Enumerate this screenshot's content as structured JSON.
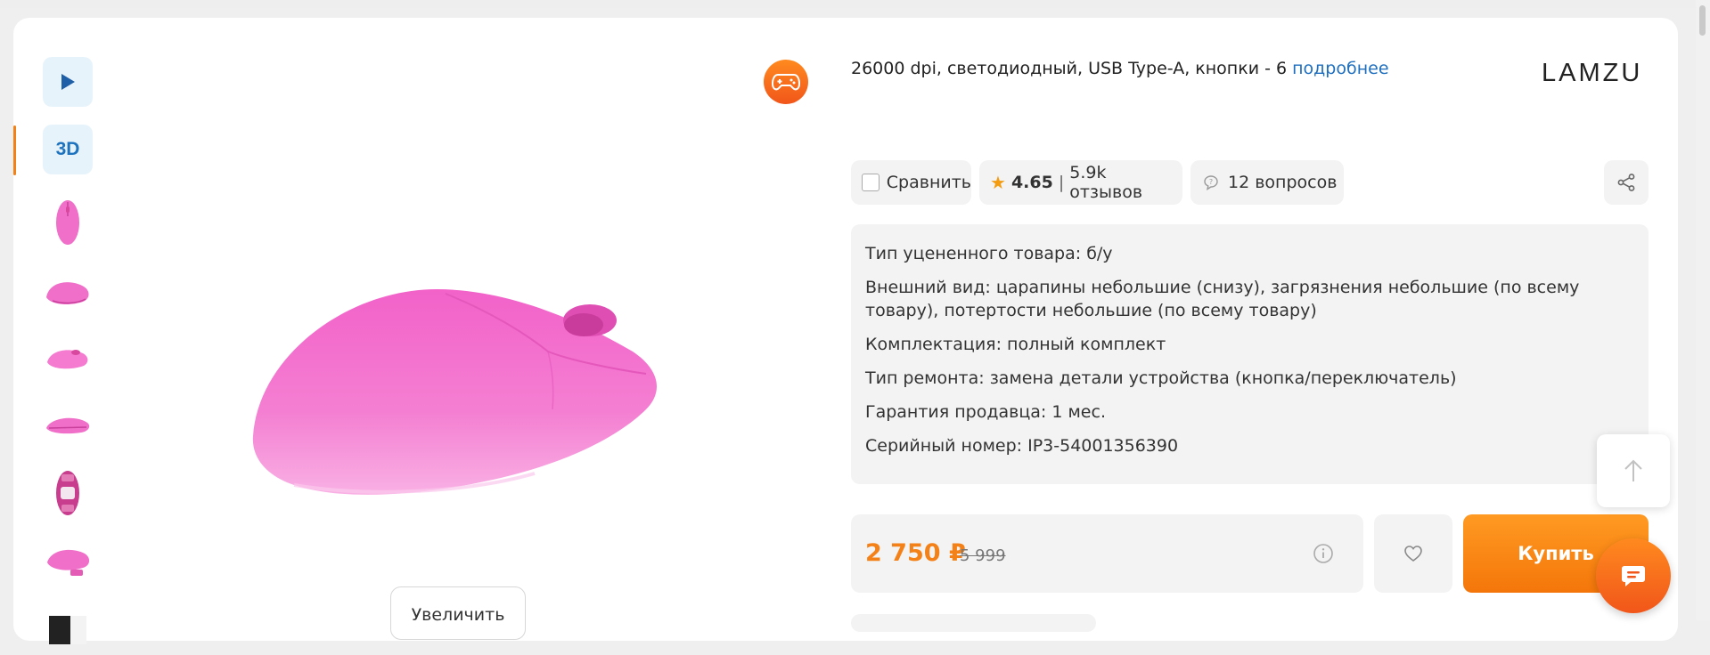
{
  "gallery": {
    "three_d_label": "3D",
    "zoom_label": "Увеличить"
  },
  "product": {
    "spec_summary": "26000 dpi, светодиодный, USB Type-A, кнопки - 6",
    "more_link": "подробнее",
    "brand": "LAMZU"
  },
  "actions": {
    "compare_label": "Сравнить",
    "rating": "4.65",
    "reviews": "5.9k отзывов",
    "rating_separator": "|",
    "questions": "12 вопросов"
  },
  "condition": {
    "rows": [
      "Тип уцененного товара: б/у",
      "Внешний вид: царапины небольшие (снизу), загрязнения небольшие (по всему товару), потертости небольшие (по всему товару)",
      "Комплектация: полный комплект",
      "Тип ремонта: замена детали устройства (кнопка/переключатель)",
      "Гарантия продавца: 1 мес.",
      "Серийный номер: IP3-54001356390"
    ]
  },
  "purchase": {
    "price": "2 750 ₽",
    "old_price": "5 999",
    "buy_label": "Купить"
  },
  "colors": {
    "accent": "#f38117",
    "link": "#1f6fbf",
    "product_pink": "#f06fc8"
  }
}
